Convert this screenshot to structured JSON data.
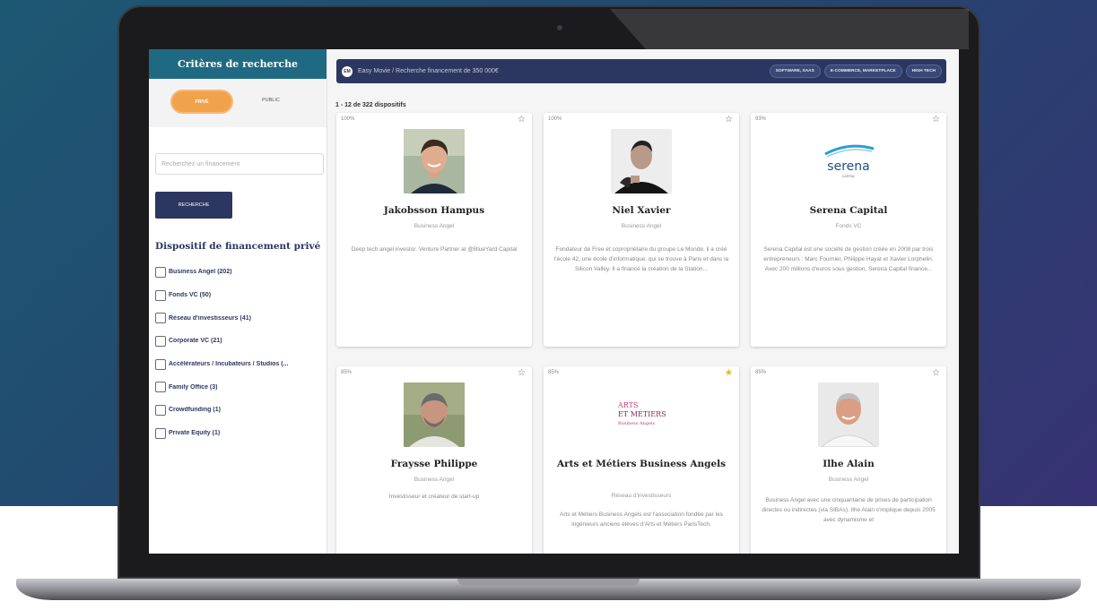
{
  "sidebar": {
    "header": "Critères de recherche",
    "toggle_active": "PRIVÉ",
    "toggle_inactive": "PUBLIC",
    "search_placeholder": "Recherchez un financement",
    "search_button": "RECHERCHE",
    "section_title": "Dispositif de financement privé",
    "filters": [
      {
        "label": "Business Angel (202)"
      },
      {
        "label": "Fonds VC (50)"
      },
      {
        "label": "Réseau d'investisseurs (41)"
      },
      {
        "label": "Corporate VC (21)"
      },
      {
        "label": "Accélérateurs / Incubateurs / Studios (..."
      },
      {
        "label": "Family Office (3)"
      },
      {
        "label": "Crowdfunding (1)"
      },
      {
        "label": "Private Equity (1)"
      }
    ]
  },
  "topbar": {
    "logo": "EM",
    "text": "Easy Movie / Recherche financement de  350 000€",
    "tags": [
      "SOFTWARE, SAAS",
      "E-COMMERCE, MARKETPLACE",
      "HIGH TECH"
    ]
  },
  "results_count": "1 - 12 de 322 dispositifs",
  "cards": [
    {
      "score": "100%",
      "starred": false,
      "name": "Jakobsson Hampus",
      "type": "Business Angel",
      "description": "Deep tech angel investor. Venture Partner at @BlueYard Capital"
    },
    {
      "score": "100%",
      "starred": false,
      "name": "Niel Xavier",
      "type": "Business Angel",
      "description": "Fondateur de Free et copropriétaire du groupe Le Monde, il a créé l'école 42, une école d'informatique, qui se trouve à Paris et dans la Silicon Valley. Il a financé la création de la Station..."
    },
    {
      "score": "93%",
      "starred": false,
      "name": "Serena Capital",
      "type": "Fonds VC",
      "logo_text": "serena",
      "logo_sub": "CAPITAL",
      "description": "Serena Capital est une société de gestion créée en 2008 par trois entrepreneurs : Marc Fournier, Philippe Hayat et Xavier Lorphelin. Avec 200 millions d'euros sous gestion, Serena Capital finance..."
    },
    {
      "score": "85%",
      "starred": false,
      "name": "Fraysse Philippe",
      "type": "Business Angel",
      "description": "Investisseur et créateur de start-up"
    },
    {
      "score": "85%",
      "starred": true,
      "name": "Arts et Métiers Business Angels",
      "type": "Réseau d'investisseurs",
      "logo_line1": "ARTS",
      "logo_line2": "ET MÉTIERS",
      "logo_line3": "Business Angels",
      "description": "Arts et Métiers Business Angels est l'association fondée par les ingénieurs anciens élèves d'Arts et Métiers ParisTech."
    },
    {
      "score": "85%",
      "starred": false,
      "name": "Ilhe Alain",
      "type": "Business Angel",
      "description": "Business Angel avec une cinquantaine de prises de participation directes ou indirectes (via SIBAs). Ilhe Alain s'implique depuis 2005 avec dynamisme et"
    }
  ],
  "icons": {
    "star": "☆",
    "star_filled": "★"
  },
  "colors": {
    "accent": "#f2a24a",
    "navy": "#2b3760",
    "teal": "#1f6a82"
  }
}
